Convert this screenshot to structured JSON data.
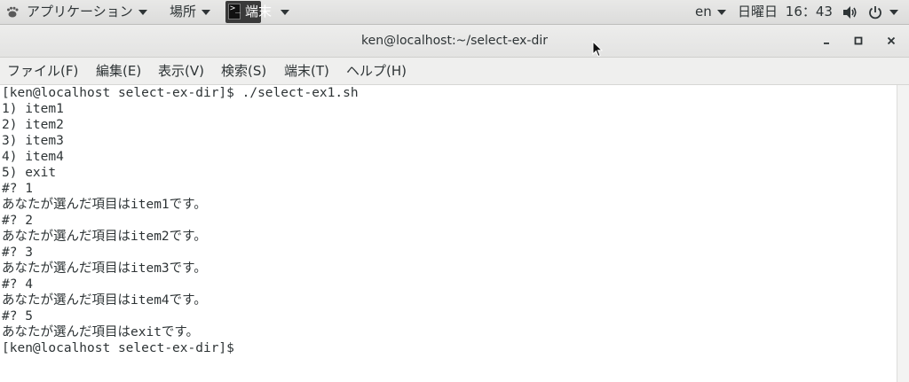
{
  "topbar": {
    "apps_label": "アプリケーション",
    "places_label": "場所",
    "terminal_label": "端末",
    "terminal_glyph": ">_",
    "lang": "en",
    "day": "日曜日",
    "time": "16：43"
  },
  "window": {
    "title": "ken@localhost:~/select-ex-dir",
    "minimize_glyph": "–",
    "maximize_glyph": "□",
    "close_glyph": "×"
  },
  "menubar": {
    "items": [
      "ファイル(F)",
      "編集(E)",
      "表示(V)",
      "検索(S)",
      "端末(T)",
      "ヘルプ(H)"
    ]
  },
  "terminal": {
    "lines": [
      "[ken@localhost select-ex-dir]$ ./select-ex1.sh",
      "1) item1",
      "2) item2",
      "3) item3",
      "4) item4",
      "5) exit",
      "#? 1",
      "あなたが選んだ項目はitem1です。",
      "#? 2",
      "あなたが選んだ項目はitem2です。",
      "#? 3",
      "あなたが選んだ項目はitem3です。",
      "#? 4",
      "あなたが選んだ項目はitem4です。",
      "#? 5",
      "あなたが選んだ項目はexitです。",
      "[ken@localhost select-ex-dir]$"
    ]
  }
}
